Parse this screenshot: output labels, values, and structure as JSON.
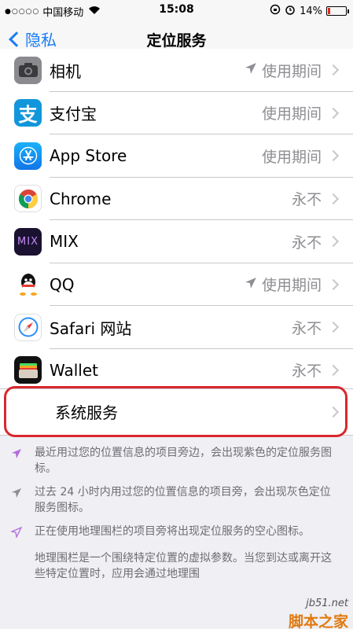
{
  "status_bar": {
    "carrier": "中国移动",
    "time": "15:08",
    "battery": "14%",
    "battery_level": 0.14
  },
  "navbar": {
    "back_label": "隐私",
    "title": "定位服务"
  },
  "apps": [
    {
      "name": "相机",
      "status": "使用期间",
      "arrow": true,
      "icon": "camera-icon"
    },
    {
      "name": "支付宝",
      "status": "使用期间",
      "arrow": false,
      "icon": "alipay-icon"
    },
    {
      "name": "App Store",
      "status": "使用期间",
      "arrow": false,
      "icon": "app-store-icon"
    },
    {
      "name": "Chrome",
      "status": "永不",
      "arrow": false,
      "icon": "chrome-icon"
    },
    {
      "name": "MIX",
      "status": "永不",
      "arrow": false,
      "icon": "mix-icon"
    },
    {
      "name": "QQ",
      "status": "使用期间",
      "arrow": true,
      "icon": "qq-icon"
    },
    {
      "name": "Safari 网站",
      "status": "永不",
      "arrow": false,
      "icon": "safari-icon"
    },
    {
      "name": "Wallet",
      "status": "永不",
      "arrow": false,
      "icon": "wallet-icon"
    }
  ],
  "system_services": {
    "label": "系统服务"
  },
  "notes": {
    "purple": "最近用过您的位置信息的项目旁边，会出现紫色的定位服务图标。",
    "gray": "过去 24 小时内用过您的位置信息的项目旁，会出现灰色定位服务图标。",
    "hollow": "正在使用地理围栏的项目旁将出现定位服务的空心图标。",
    "geofence": "地理围栏是一个围绕特定位置的虚拟参数。当您到达或离开这些特定位置时，应用会通过地理围"
  },
  "watermark": {
    "url": "jb51.net",
    "brand": "脚本之家"
  },
  "colors": {
    "accent": "#1a7cf5",
    "highlight": "#d9272e",
    "purple_arrow": "#b26bdb"
  }
}
